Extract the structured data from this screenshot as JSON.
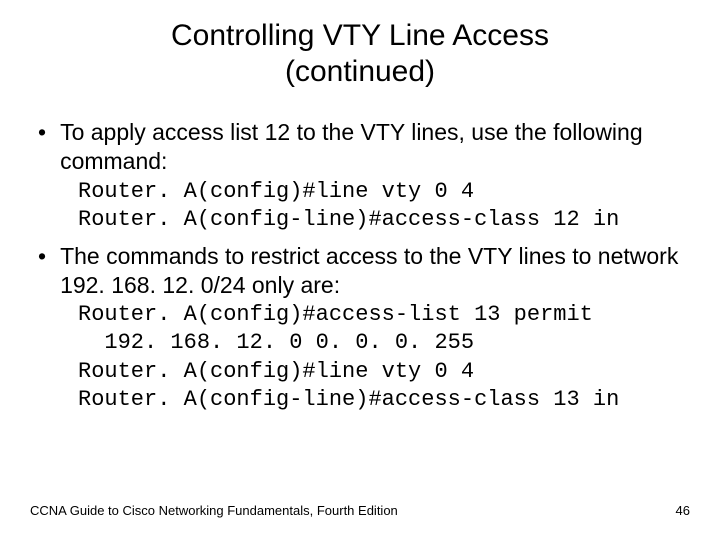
{
  "title_line1": "Controlling VTY Line Access",
  "title_line2": "(continued)",
  "bullets": [
    {
      "text": "To apply access list 12 to the VTY lines, use the following command:",
      "code": "Router. A(config)#line vty 0 4\nRouter. A(config-line)#access-class 12 in"
    },
    {
      "text": "The commands to restrict access to the VTY lines to network 192. 168. 12. 0/24 only are:",
      "code": "Router. A(config)#access-list 13 permit\n  192. 168. 12. 0 0. 0. 0. 255\nRouter. A(config)#line vty 0 4\nRouter. A(config-line)#access-class 13 in"
    }
  ],
  "footer_left": "CCNA Guide to Cisco Networking Fundamentals, Fourth Edition",
  "footer_right": "46"
}
